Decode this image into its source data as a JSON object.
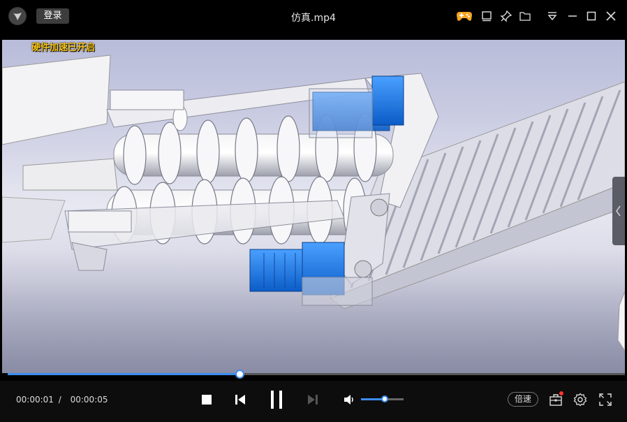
{
  "window": {
    "title": "仿真.mp4",
    "login_label": "登录"
  },
  "titlebar_icons": [
    "gamepad-icon",
    "mini-mode-icon",
    "pin-icon",
    "folder-icon",
    "dropdown-menu-icon",
    "minimize-icon",
    "maximize-icon",
    "close-icon"
  ],
  "video": {
    "notice": "硬件加速已开启"
  },
  "playback": {
    "progress_percent": 37.6,
    "current_time": "00:00:01",
    "separator": "/",
    "total_time": "00:00:05",
    "volume_percent": 55,
    "speed_label": "倍速"
  },
  "colors": {
    "accent": "#3b8df0",
    "notice": "#f6c51a",
    "motor_blue": "#1f78e6",
    "badge_red": "#ff3333"
  }
}
